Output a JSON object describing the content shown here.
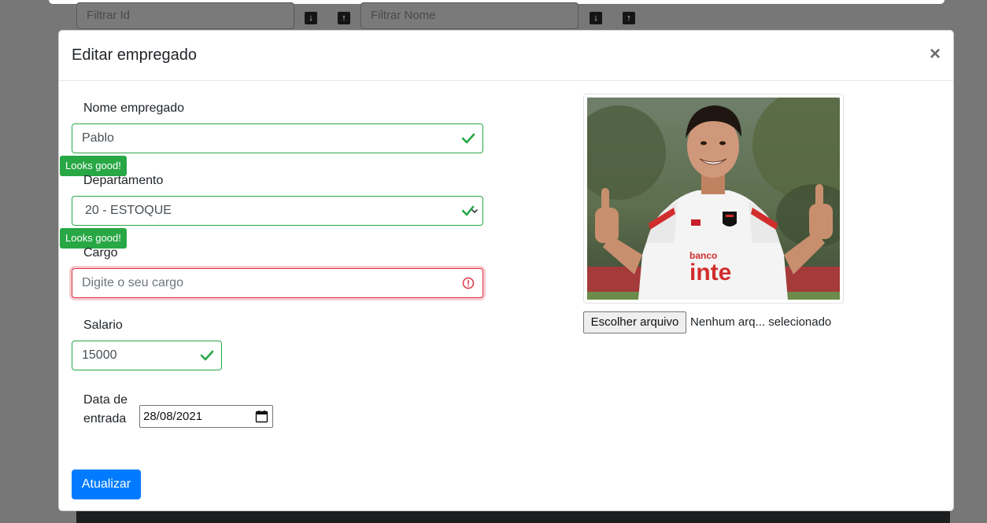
{
  "background": {
    "filters": [
      {
        "placeholder": "Filtrar Id",
        "sort_down": "↓",
        "sort_up": "↑"
      },
      {
        "placeholder": "Filtrar Nome",
        "sort_down": "↓",
        "sort_up": "↑"
      }
    ]
  },
  "modal": {
    "title": "Editar empregado",
    "close_label": "×",
    "form": {
      "name": {
        "label": "Nome empregado",
        "value": "Pablo",
        "feedback": "Looks good!"
      },
      "department": {
        "label": "Departamento",
        "value": "20 - ESTOQUE",
        "feedback": "Looks good!"
      },
      "role": {
        "label": "Cargo",
        "placeholder": "Digite o seu cargo"
      },
      "salary": {
        "label": "Salario",
        "value": "15000"
      },
      "start_date": {
        "label_line1": "Data de",
        "label_line2": "entrada",
        "value": "28/08/2021"
      },
      "submit_label": "Atualizar"
    },
    "photo": {
      "file_button_label": "Escolher arquivo",
      "file_status": "Nenhum arq... selecionado"
    }
  },
  "colors": {
    "valid": "#28a745",
    "invalid": "#dc3545",
    "primary": "#007bff"
  }
}
